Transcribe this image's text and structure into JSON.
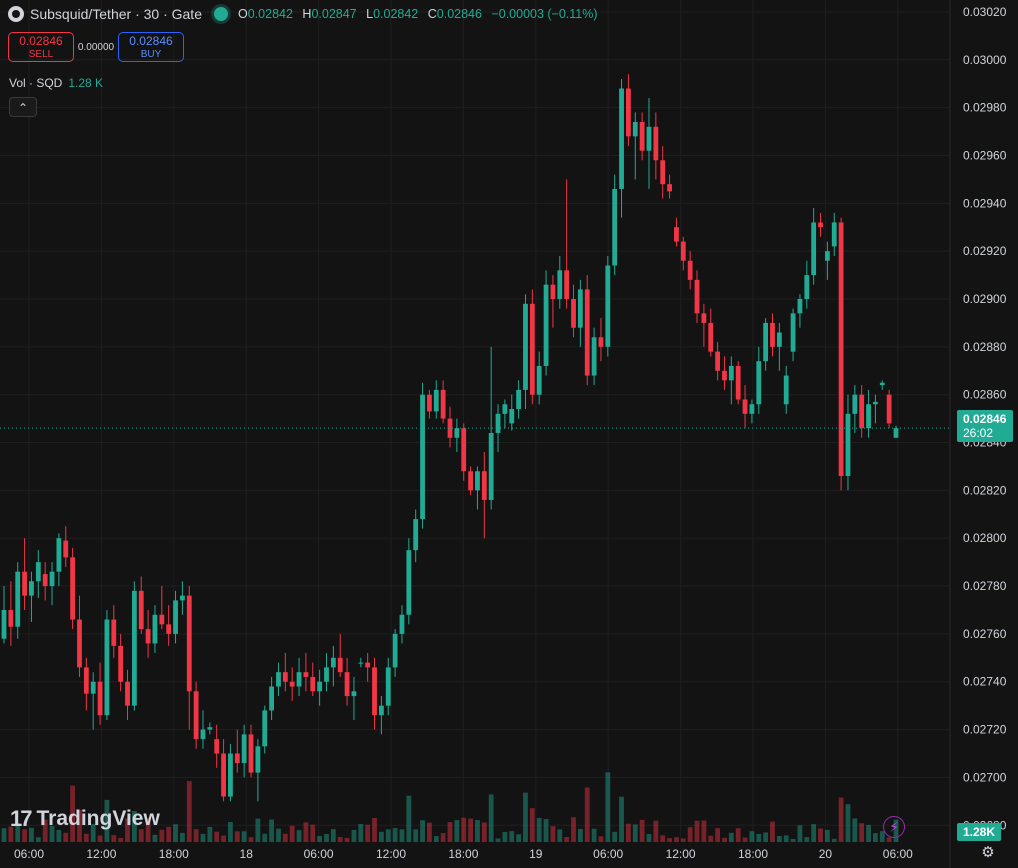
{
  "header": {
    "symbol": "Subsquid/Tether · 30 · Gate",
    "ohlc": [
      {
        "k": "O",
        "v": "0.02842"
      },
      {
        "k": "H",
        "v": "0.02847"
      },
      {
        "k": "L",
        "v": "0.02842"
      },
      {
        "k": "C",
        "v": "0.02846"
      },
      {
        "k": "",
        "v": "−0.00003 (−0.11%)"
      }
    ]
  },
  "trade": {
    "sell_price": "0.02846",
    "sell_label": "SELL",
    "spread": "0.00000",
    "buy_price": "0.02846",
    "buy_label": "BUY"
  },
  "volume_legend": {
    "label": "Vol · SQD",
    "value": "1.28 K"
  },
  "price_tag": {
    "price": "0.02846",
    "countdown": "26:02"
  },
  "volume_tag": "1.28K",
  "branding": "TradingView",
  "colors": {
    "up": "#22ab94",
    "down": "#f23645",
    "background": "#131313",
    "grid": "#1f1f1f"
  },
  "chart_data": {
    "type": "candlestick",
    "interval": "30",
    "price_axis": {
      "ticks": [
        "0.03020",
        "0.03000",
        "0.02980",
        "0.02960",
        "0.02940",
        "0.02920",
        "0.02900",
        "0.02880",
        "0.02860",
        "0.02840",
        "0.02820",
        "0.02800",
        "0.02780",
        "0.02760",
        "0.02740",
        "0.02720",
        "0.02700",
        "0.02680"
      ],
      "range": [
        0.02673,
        0.03025
      ]
    },
    "time_axis": [
      "06:00",
      "12:00",
      "18:00",
      "18",
      "06:00",
      "12:00",
      "18:00",
      "19",
      "06:00",
      "12:00",
      "18:00",
      "20",
      "06:00"
    ],
    "candles": [
      [
        0.02758,
        0.0278,
        0.02756,
        0.0277
      ],
      [
        0.0277,
        0.02782,
        0.02755,
        0.02763
      ],
      [
        0.02763,
        0.0279,
        0.02758,
        0.02786
      ],
      [
        0.02786,
        0.028,
        0.0277,
        0.02776
      ],
      [
        0.02776,
        0.02786,
        0.02765,
        0.02782
      ],
      [
        0.02782,
        0.02795,
        0.02775,
        0.0279
      ],
      [
        0.02785,
        0.0279,
        0.02774,
        0.0278
      ],
      [
        0.0278,
        0.0279,
        0.02772,
        0.02786
      ],
      [
        0.02786,
        0.02802,
        0.0278,
        0.028
      ],
      [
        0.02799,
        0.02805,
        0.02788,
        0.02792
      ],
      [
        0.02792,
        0.02796,
        0.02762,
        0.02766
      ],
      [
        0.02766,
        0.02776,
        0.02742,
        0.02746
      ],
      [
        0.02746,
        0.0275,
        0.02728,
        0.02735
      ],
      [
        0.02735,
        0.02744,
        0.0272,
        0.0274
      ],
      [
        0.0274,
        0.02748,
        0.02722,
        0.02726
      ],
      [
        0.02726,
        0.0277,
        0.02724,
        0.02766
      ],
      [
        0.02766,
        0.02772,
        0.0275,
        0.02755
      ],
      [
        0.02755,
        0.0276,
        0.02736,
        0.0274
      ],
      [
        0.0274,
        0.02745,
        0.02724,
        0.0273
      ],
      [
        0.0273,
        0.02782,
        0.02728,
        0.02778
      ],
      [
        0.02778,
        0.02784,
        0.0276,
        0.02762
      ],
      [
        0.02762,
        0.0277,
        0.0275,
        0.02756
      ],
      [
        0.02756,
        0.02772,
        0.02752,
        0.02768
      ],
      [
        0.02768,
        0.0278,
        0.02762,
        0.02764
      ],
      [
        0.02764,
        0.02772,
        0.02755,
        0.0276
      ],
      [
        0.0276,
        0.02778,
        0.02756,
        0.02774
      ],
      [
        0.02774,
        0.02782,
        0.02768,
        0.02776
      ],
      [
        0.02776,
        0.0278,
        0.0272,
        0.02736
      ],
      [
        0.02736,
        0.0274,
        0.02712,
        0.02716
      ],
      [
        0.02716,
        0.02728,
        0.02712,
        0.0272
      ],
      [
        0.0272,
        0.02723,
        0.02718,
        0.02721
      ],
      [
        0.02716,
        0.02722,
        0.02704,
        0.0271
      ],
      [
        0.0271,
        0.02716,
        0.0269,
        0.02692
      ],
      [
        0.02692,
        0.02714,
        0.0269,
        0.0271
      ],
      [
        0.0271,
        0.0272,
        0.02702,
        0.02706
      ],
      [
        0.02706,
        0.02722,
        0.027,
        0.02718
      ],
      [
        0.02718,
        0.02722,
        0.027,
        0.02702
      ],
      [
        0.02702,
        0.02716,
        0.0269,
        0.02713
      ],
      [
        0.02713,
        0.0273,
        0.0271,
        0.02728
      ],
      [
        0.02728,
        0.02742,
        0.02724,
        0.02738
      ],
      [
        0.02738,
        0.02748,
        0.02734,
        0.02744
      ],
      [
        0.02744,
        0.02752,
        0.02736,
        0.0274
      ],
      [
        0.0274,
        0.02746,
        0.02732,
        0.02738
      ],
      [
        0.02738,
        0.0275,
        0.02734,
        0.02744
      ],
      [
        0.02744,
        0.02752,
        0.02736,
        0.02742
      ],
      [
        0.02742,
        0.02748,
        0.02734,
        0.02736
      ],
      [
        0.02736,
        0.02745,
        0.0273,
        0.0274
      ],
      [
        0.0274,
        0.02752,
        0.02736,
        0.02746
      ],
      [
        0.02746,
        0.02755,
        0.02738,
        0.0275
      ],
      [
        0.0275,
        0.0276,
        0.02742,
        0.02744
      ],
      [
        0.02744,
        0.0275,
        0.0273,
        0.02734
      ],
      [
        0.02734,
        0.02742,
        0.02724,
        0.02736
      ],
      [
        0.02748,
        0.0275,
        0.02746,
        0.02748
      ],
      [
        0.02748,
        0.02752,
        0.0274,
        0.02746
      ],
      [
        0.02746,
        0.0275,
        0.0272,
        0.02726
      ],
      [
        0.02726,
        0.02734,
        0.02718,
        0.0273
      ],
      [
        0.0273,
        0.0275,
        0.02726,
        0.02746
      ],
      [
        0.02746,
        0.02762,
        0.02742,
        0.0276
      ],
      [
        0.0276,
        0.02772,
        0.02756,
        0.02768
      ],
      [
        0.02768,
        0.028,
        0.02764,
        0.02795
      ],
      [
        0.02795,
        0.02812,
        0.0279,
        0.02808
      ],
      [
        0.02808,
        0.02865,
        0.02804,
        0.0286
      ],
      [
        0.0286,
        0.02862,
        0.0285,
        0.02853
      ],
      [
        0.02853,
        0.02866,
        0.0285,
        0.02862
      ],
      [
        0.02862,
        0.02866,
        0.02848,
        0.0285
      ],
      [
        0.0285,
        0.02855,
        0.02838,
        0.02842
      ],
      [
        0.02842,
        0.0285,
        0.02836,
        0.02846
      ],
      [
        0.02846,
        0.02848,
        0.02824,
        0.02828
      ],
      [
        0.02828,
        0.0283,
        0.02818,
        0.0282
      ],
      [
        0.0282,
        0.0283,
        0.02812,
        0.02828
      ],
      [
        0.02828,
        0.02836,
        0.028,
        0.02816
      ],
      [
        0.02816,
        0.0288,
        0.02812,
        0.02844
      ],
      [
        0.02844,
        0.02856,
        0.02836,
        0.02852
      ],
      [
        0.02852,
        0.02858,
        0.02846,
        0.02856
      ],
      [
        0.02848,
        0.0286,
        0.02845,
        0.02854
      ],
      [
        0.02854,
        0.02866,
        0.0285,
        0.02862
      ],
      [
        0.02862,
        0.02902,
        0.02854,
        0.02898
      ],
      [
        0.02898,
        0.02904,
        0.02856,
        0.0286
      ],
      [
        0.0286,
        0.02878,
        0.02856,
        0.02872
      ],
      [
        0.02872,
        0.02912,
        0.02868,
        0.02906
      ],
      [
        0.02906,
        0.0291,
        0.02888,
        0.029
      ],
      [
        0.029,
        0.02918,
        0.02896,
        0.02912
      ],
      [
        0.02912,
        0.0295,
        0.02896,
        0.029
      ],
      [
        0.029,
        0.02906,
        0.02884,
        0.02888
      ],
      [
        0.02888,
        0.02908,
        0.0288,
        0.02904
      ],
      [
        0.02904,
        0.0291,
        0.02864,
        0.02868
      ],
      [
        0.02868,
        0.02888,
        0.02864,
        0.02884
      ],
      [
        0.02884,
        0.02892,
        0.02874,
        0.0288
      ],
      [
        0.0288,
        0.02918,
        0.02876,
        0.02914
      ],
      [
        0.02914,
        0.02952,
        0.0291,
        0.02946
      ],
      [
        0.02946,
        0.02992,
        0.02934,
        0.02988
      ],
      [
        0.02988,
        0.02994,
        0.02964,
        0.02968
      ],
      [
        0.02968,
        0.02978,
        0.0295,
        0.02974
      ],
      [
        0.02974,
        0.02978,
        0.02958,
        0.02962
      ],
      [
        0.02962,
        0.02984,
        0.02946,
        0.02972
      ],
      [
        0.02972,
        0.02978,
        0.0295,
        0.02958
      ],
      [
        0.02958,
        0.02964,
        0.02942,
        0.02948
      ],
      [
        0.02948,
        0.02952,
        0.02942,
        0.02945
      ],
      [
        0.0293,
        0.02934,
        0.02922,
        0.02924
      ],
      [
        0.02924,
        0.02926,
        0.02912,
        0.02916
      ],
      [
        0.02916,
        0.0292,
        0.02904,
        0.02908
      ],
      [
        0.02908,
        0.02912,
        0.0289,
        0.02894
      ],
      [
        0.02894,
        0.02898,
        0.0288,
        0.0289
      ],
      [
        0.0289,
        0.02896,
        0.02876,
        0.02878
      ],
      [
        0.02878,
        0.02882,
        0.02866,
        0.0287
      ],
      [
        0.0287,
        0.02876,
        0.02862,
        0.02866
      ],
      [
        0.02866,
        0.02876,
        0.02856,
        0.02872
      ],
      [
        0.02872,
        0.02874,
        0.02856,
        0.02858
      ],
      [
        0.02858,
        0.02864,
        0.02846,
        0.02852
      ],
      [
        0.02852,
        0.02858,
        0.02848,
        0.02856
      ],
      [
        0.02856,
        0.0288,
        0.02852,
        0.02874
      ],
      [
        0.02874,
        0.02892,
        0.0287,
        0.0289
      ],
      [
        0.0289,
        0.02894,
        0.02876,
        0.0288
      ],
      [
        0.0288,
        0.0289,
        0.0287,
        0.02886
      ],
      [
        0.02856,
        0.02872,
        0.02852,
        0.02868
      ],
      [
        0.02878,
        0.02896,
        0.02874,
        0.02894
      ],
      [
        0.02894,
        0.02902,
        0.02888,
        0.029
      ],
      [
        0.029,
        0.02916,
        0.02896,
        0.0291
      ],
      [
        0.0291,
        0.02938,
        0.02906,
        0.02932
      ],
      [
        0.02932,
        0.02936,
        0.02926,
        0.0293
      ],
      [
        0.02916,
        0.02924,
        0.02908,
        0.0292
      ],
      [
        0.02922,
        0.02936,
        0.02918,
        0.02932
      ],
      [
        0.02932,
        0.02934,
        0.0282,
        0.02826
      ],
      [
        0.02826,
        0.0286,
        0.0282,
        0.02852
      ],
      [
        0.02852,
        0.02864,
        0.02844,
        0.0286
      ],
      [
        0.0286,
        0.02864,
        0.02842,
        0.02846
      ],
      [
        0.02846,
        0.02862,
        0.02842,
        0.02856
      ],
      [
        0.02856,
        0.0286,
        0.02848,
        0.02857
      ],
      [
        0.02864,
        0.02866,
        0.02862,
        0.02865
      ],
      [
        0.0286,
        0.02862,
        0.02846,
        0.02848
      ],
      [
        0.02842,
        0.02847,
        0.02842,
        0.02846
      ]
    ],
    "volume_max_k": 5.2
  }
}
